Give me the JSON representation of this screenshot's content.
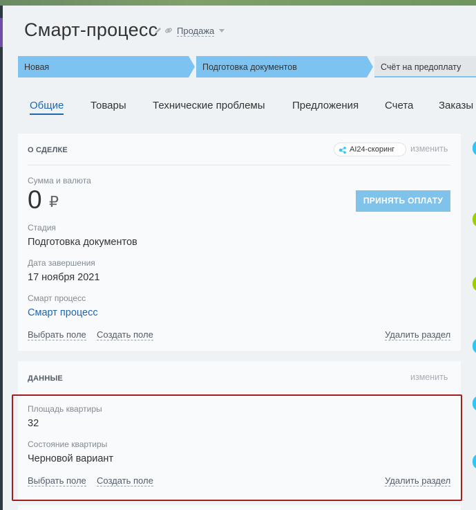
{
  "header": {
    "title": "Смарт-процесс",
    "category": "Продажа"
  },
  "stages": [
    {
      "label": "Новая",
      "color": "#7dc3f2"
    },
    {
      "label": "Подготовка документов",
      "color": "#7dc3f2"
    },
    {
      "label": "Счёт на предоплату",
      "color": "#e3e6e9"
    }
  ],
  "tabs": [
    {
      "label": "Общие",
      "active": true
    },
    {
      "label": "Товары"
    },
    {
      "label": "Технические проблемы"
    },
    {
      "label": "Предложения"
    },
    {
      "label": "Счета"
    },
    {
      "label": "Заказы"
    }
  ],
  "deal_card": {
    "title": "О СДЕЛКЕ",
    "ai_badge": "AI24-скоринг",
    "edit_label": "изменить",
    "amount_label": "Сумма и валюта",
    "amount_value": "0",
    "currency": "₽",
    "pay_button": "ПРИНЯТЬ ОПЛАТУ",
    "stage_label": "Стадия",
    "stage_value": "Подготовка документов",
    "close_date_label": "Дата завершения",
    "close_date_value": "17 ноября 2021",
    "smart_process_label": "Смарт процесс",
    "smart_process_value": "Смарт процесс",
    "select_field": "Выбрать поле",
    "create_field": "Создать поле",
    "delete_section": "Удалить раздел"
  },
  "data_card": {
    "title": "ДАННЫЕ",
    "edit_label": "изменить",
    "area_label": "Площадь квартиры",
    "area_value": "32",
    "condition_label": "Состояние квартиры",
    "condition_value": "Черновой вариант",
    "select_field": "Выбрать поле",
    "create_field": "Создать поле",
    "delete_section": "Удалить раздел"
  },
  "colors": {
    "accent": "#2067b0",
    "stage_active": "#7dc3f2",
    "stage_inactive": "#e3e6e9",
    "pay_button": "#7fc3ea",
    "highlight": "#a41e1e"
  },
  "side_dots": [
    "#2fc6f6",
    "#9dcf00",
    "#9dcf00",
    "#2fc6f6",
    "#2fc6f6",
    "#2fc6f6"
  ]
}
